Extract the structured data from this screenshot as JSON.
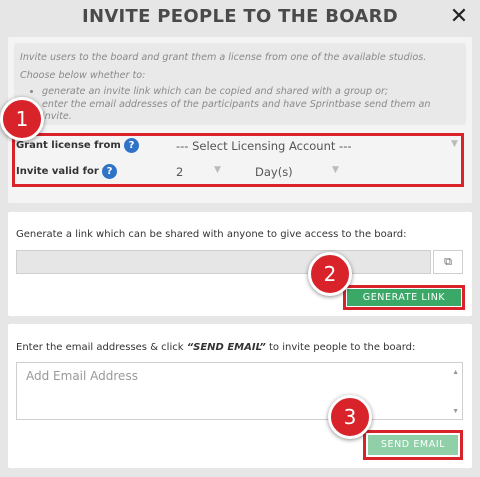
{
  "dialog": {
    "title": "INVITE PEOPLE TO THE BOARD",
    "close_glyph": "✕"
  },
  "intro": {
    "line1": "Invite users to the board and grant them a license from one of the available studios.",
    "line2": "Choose below whether to:",
    "bullets": [
      "generate an invite link which can be copied and shared with a group or;",
      "enter the email addresses of the participants and have Sprintbase send them an invite."
    ]
  },
  "license": {
    "label": "Grant license from",
    "required_mark": "*",
    "help": "?",
    "select_value": "--- Select Licensing Account ---"
  },
  "validity": {
    "label": "Invite valid for",
    "required_mark": "*",
    "help": "?",
    "amount": "2",
    "unit": "Day(s)"
  },
  "link_section": {
    "description": "Generate a link which can be shared with anyone to give access to the board:",
    "link_value": "",
    "copy_icon": "copy-icon",
    "button_label": "GENERATE LINK"
  },
  "email_section": {
    "description_before": "Enter the email addresses & click ",
    "description_emphasis": "“SEND EMAIL”",
    "description_after": " to invite people to the board:",
    "placeholder": "Add Email Address",
    "button_label": "SEND EMAIL"
  },
  "badges": [
    "1",
    "2",
    "3"
  ],
  "colors": {
    "accent_red": "#d8232a",
    "button_green": "#3aa867",
    "button_green_light": "#8fd0a8",
    "help_blue": "#2f73c9"
  }
}
